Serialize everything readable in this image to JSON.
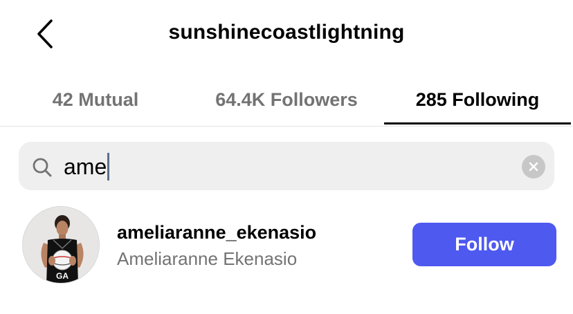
{
  "header": {
    "title": "sunshinecoastlightning",
    "back_icon": "chevron-left-icon"
  },
  "tabs": [
    {
      "label": "42 Mutual",
      "active": false
    },
    {
      "label": "64.4K Followers",
      "active": false
    },
    {
      "label": "285 Following",
      "active": true
    }
  ],
  "search": {
    "value": "ame",
    "search_icon": "magnifier-icon",
    "clear_icon": "clear-x-icon"
  },
  "results": [
    {
      "username": "ameliaranne_ekenasio",
      "full_name": "Ameliaranne Ekenasio",
      "button_label": "Follow",
      "avatar_jersey_text": "GA"
    }
  ],
  "colors": {
    "follow_button": "#4e59f0",
    "secondary_text": "#737373",
    "search_background": "#efefef"
  }
}
